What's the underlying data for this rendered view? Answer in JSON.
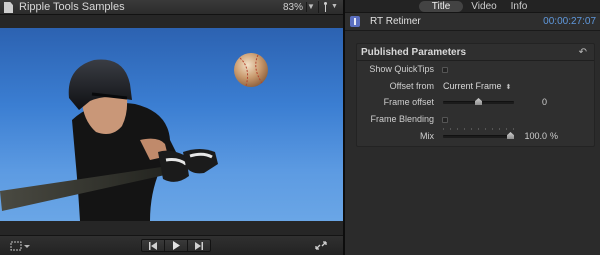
{
  "viewer": {
    "title": "Ripple Tools Samples",
    "zoom": "83%",
    "icons": [
      "document-icon",
      "chevron-down-icon",
      "viewer-options-icon",
      "crop-icon",
      "previous-frame-icon",
      "play-icon",
      "next-frame-icon",
      "fullscreen-icon"
    ]
  },
  "inspector": {
    "tabs": [
      {
        "label": "Title",
        "active": true
      },
      {
        "label": "Video",
        "active": false
      },
      {
        "label": "Info",
        "active": false
      }
    ],
    "plugin_name": "RT Retimer",
    "timecode": "00:00:27:07",
    "params": {
      "section_title": "Published Parameters",
      "show_quicktips": {
        "label": "Show QuickTips",
        "checked": false
      },
      "offset_from": {
        "label": "Offset from",
        "value": "Current Frame"
      },
      "frame_offset": {
        "label": "Frame offset",
        "value": "0",
        "position": 0.5
      },
      "frame_blending": {
        "label": "Frame Blending",
        "checked": false
      },
      "mix": {
        "label": "Mix",
        "value": "100.0",
        "unit": "%",
        "position": 1.0
      }
    }
  },
  "colors": {
    "accent_timecode": "#5f98dc",
    "plugin_icon": "#5b6fc0",
    "sky": "#3b7ed2"
  }
}
